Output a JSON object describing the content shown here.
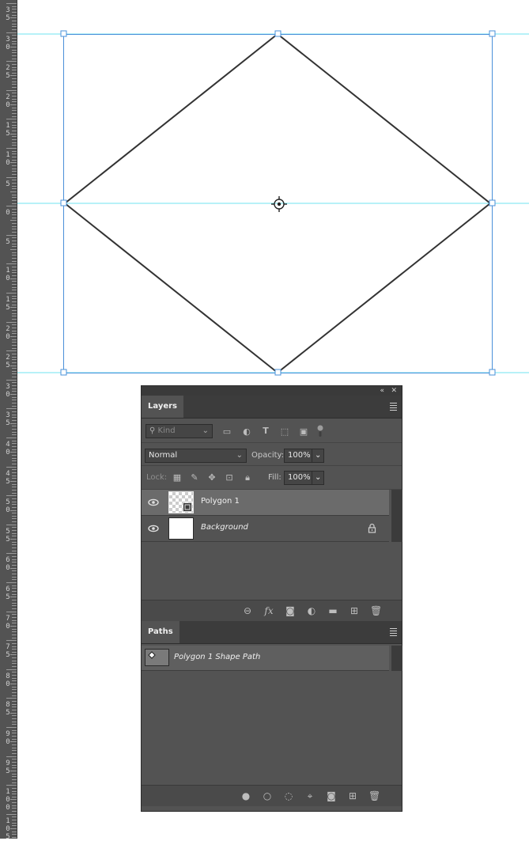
{
  "ruler": {
    "labels": [
      "3\n5",
      "3\n0",
      "2\n5",
      "2\n0",
      "1\n5",
      "1\n0",
      "5",
      "0",
      "5",
      "1\n0",
      "1\n5",
      "2\n0",
      "2\n5",
      "3\n0",
      "3\n5",
      "4\n0",
      "4\n5",
      "5\n0",
      "5\n5",
      "6\n0",
      "6\n5",
      "7\n0",
      "7\n5",
      "8\n0",
      "8\n5",
      "9\n0",
      "9\n5",
      "1\n0\n0",
      "1\n0\n5"
    ]
  },
  "canvas": {
    "background": "#ffffff",
    "guide_color": "#6fe3f0",
    "shape": {
      "type": "polygon",
      "name": "Polygon 1",
      "sides": 4,
      "stroke": "#333333"
    }
  },
  "panel": {
    "collapse_glyph": "«",
    "close_glyph": "✕",
    "layers": {
      "tab": "Layers",
      "filter_placeholder": "Kind",
      "blend_mode": "Normal",
      "opacity_label": "Opacity:",
      "opacity_value": "100%",
      "lock_label": "Lock:",
      "fill_label": "Fill:",
      "fill_value": "100%",
      "items": [
        {
          "name": "Polygon 1",
          "selected": true,
          "visible": true
        },
        {
          "name": "Background",
          "selected": false,
          "visible": true,
          "locked": true
        }
      ],
      "footer_icons": [
        "link-icon",
        "fx-icon",
        "mask-icon",
        "adjustment-icon",
        "folder-icon",
        "new-layer-icon",
        "trash-icon"
      ]
    },
    "paths": {
      "tab": "Paths",
      "items": [
        {
          "name": "Polygon 1 Shape Path"
        }
      ],
      "footer_icons": [
        "fill-path-icon",
        "stroke-path-icon",
        "selection-icon",
        "work-path-icon",
        "mask-icon",
        "new-path-icon",
        "trash-icon"
      ]
    }
  }
}
